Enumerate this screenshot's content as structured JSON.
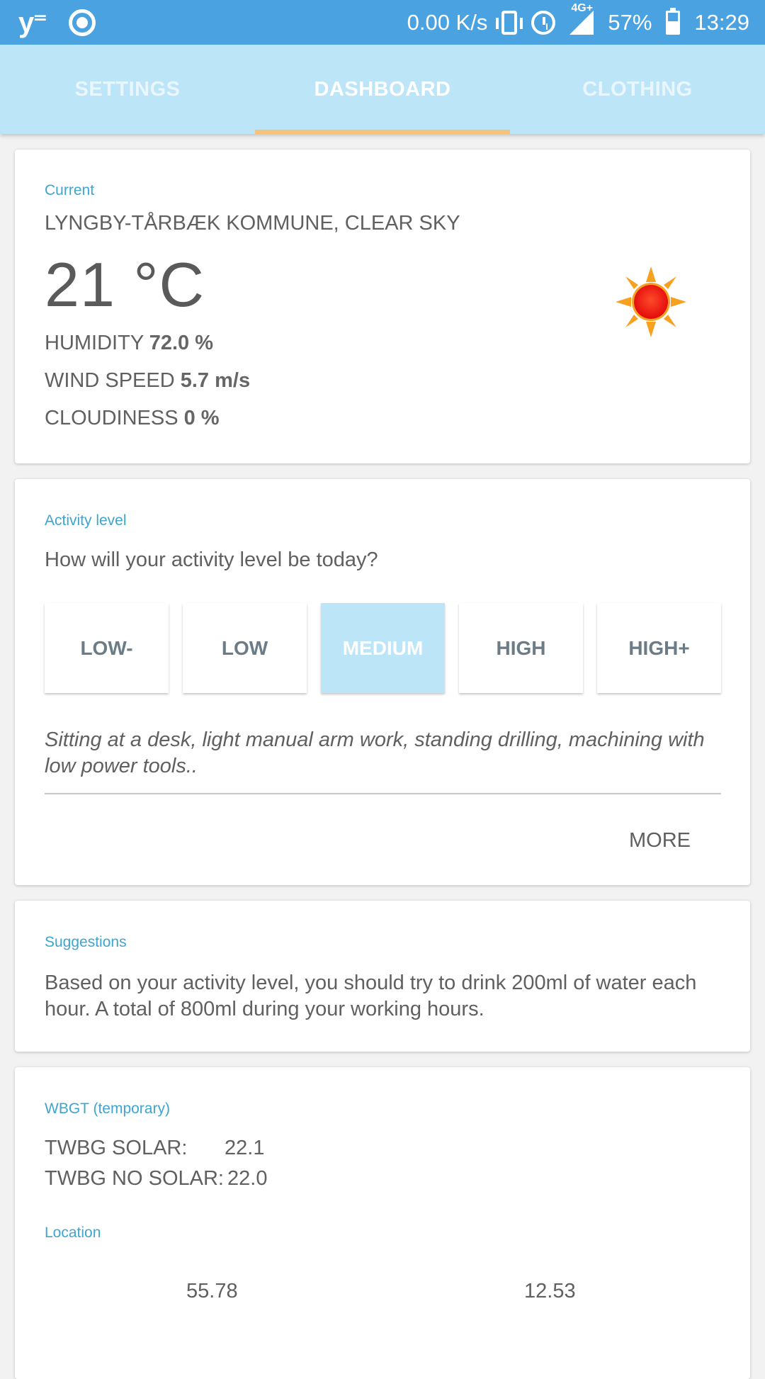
{
  "status_bar": {
    "app_icon": "y-notification-icon",
    "net_speed": "0.00 K/s",
    "network": "4G+",
    "battery": "57%",
    "time": "13:29"
  },
  "tabs": [
    {
      "label": "SETTINGS",
      "active": false
    },
    {
      "label": "DASHBOARD",
      "active": true
    },
    {
      "label": "CLOTHING",
      "active": false
    }
  ],
  "current": {
    "title": "Current",
    "location": "LYNGBY-TÅRBÆK KOMMUNE, CLEAR SKY",
    "temperature": "21 °C",
    "icon": "sun-icon",
    "humidity_label": "HUMIDITY",
    "humidity_value": "72.0 %",
    "wind_label": "WIND SPEED",
    "wind_value": "5.7 m/s",
    "cloud_label": "CLOUDINESS",
    "cloud_value": "0 %"
  },
  "activity": {
    "title": "Activity level",
    "question": "How will your activity level be today?",
    "levels": [
      "LOW-",
      "LOW",
      "MEDIUM",
      "HIGH",
      "HIGH+"
    ],
    "selected": "MEDIUM",
    "description": "Sitting at a desk, light manual arm work, standing drilling, machining with low power tools..",
    "more_label": "MORE"
  },
  "suggestions": {
    "title": "Suggestions",
    "text": "Based on your activity level, you should try to drink 200ml of water each hour. A total of 800ml during your working hours."
  },
  "wbgt": {
    "title": "WBGT (temporary)",
    "solar_label": "TWBG SOLAR:",
    "solar_value": "22.1",
    "nosolar_label": "TWBG NO SOLAR:",
    "nosolar_value": "22.0"
  },
  "location": {
    "title": "Location",
    "lat": "55.78",
    "lon": "12.53"
  },
  "colors": {
    "status_bar": "#4aa3e0",
    "tab_bar": "#bde5f8",
    "tab_indicator": "#f6c27b",
    "section_title": "#3ea5cf",
    "selected_level": "#bde5f8"
  }
}
